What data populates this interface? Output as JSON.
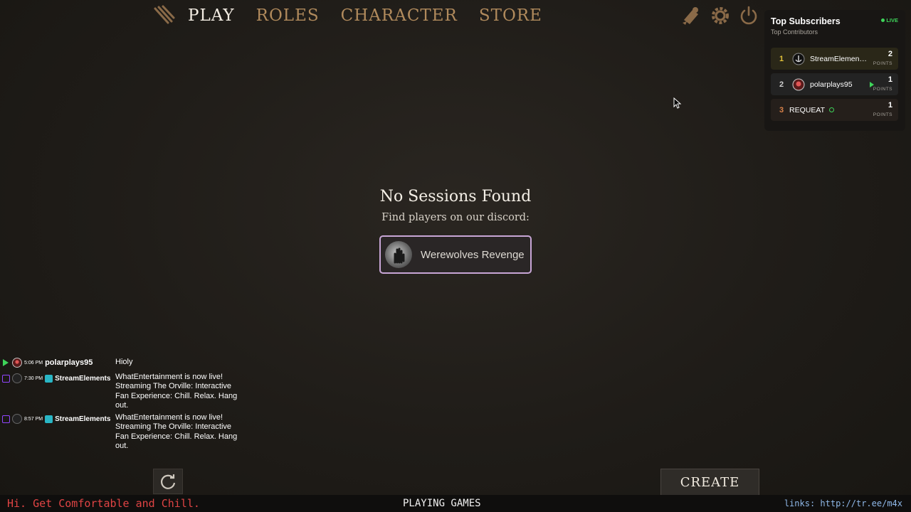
{
  "nav": {
    "items": [
      {
        "label": "PLAY",
        "active": true
      },
      {
        "label": "ROLES",
        "active": false
      },
      {
        "label": "CHARACTER",
        "active": false
      },
      {
        "label": "STORE",
        "active": false
      }
    ],
    "icons": [
      "scroll-icon",
      "gear-icon",
      "power-icon"
    ]
  },
  "subscribers": {
    "title": "Top Subscribers",
    "subtitle": "Top Contributors",
    "live_label": "LIVE",
    "points_label": "POINTS",
    "rows": [
      {
        "rank": "1",
        "name": "StreamElement...",
        "points": "2"
      },
      {
        "rank": "2",
        "name": "polarplays95",
        "points": "1"
      },
      {
        "rank": "3",
        "name": "REQUEAT",
        "points": "1"
      }
    ]
  },
  "main": {
    "title": "No Sessions Found",
    "subtitle": "Find players on our discord:",
    "discord_button": "Werewolves Revenge"
  },
  "chat": [
    {
      "time": "5:06 PM",
      "user": "polarplays95",
      "text": "Hioly"
    },
    {
      "time": "7:30 PM",
      "user": "StreamElements",
      "text": "WhatEntertainment is now live! Streaming The Orville: Interactive Fan Experience: Chill. Relax. Hang out."
    },
    {
      "time": "8:57 PM",
      "user": "StreamElements",
      "text": "WhatEntertainment is now live! Streaming The Orville: Interactive Fan Experience: Chill. Relax. Hang out."
    }
  ],
  "buttons": {
    "create": "CREATE"
  },
  "ticker": {
    "left": "Hi. Get Comfortable and Chill.",
    "middle": "PLAYING GAMES",
    "right": "links: http://tr.ee/m4x"
  },
  "colors": {
    "accent": "#b08a5c",
    "live": "#3ed45a",
    "discord_border": "#c8a6d6",
    "ticker_red": "#e04444"
  }
}
